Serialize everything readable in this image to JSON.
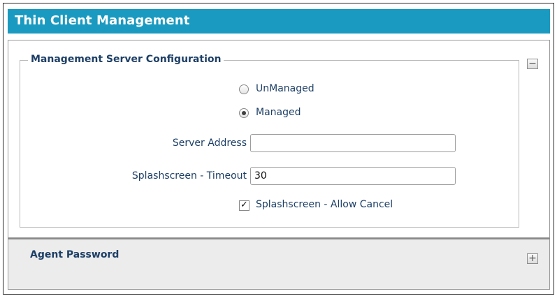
{
  "header": {
    "title": "Thin Client Management"
  },
  "management_server": {
    "legend": "Management Server Configuration",
    "collapse_symbol": "−",
    "mode_options": [
      {
        "label": "UnManaged",
        "checked": false
      },
      {
        "label": "Managed",
        "checked": true
      }
    ],
    "server_address": {
      "label": "Server Address",
      "value": ""
    },
    "splash_timeout": {
      "label": "Splashscreen - Timeout",
      "value": "30"
    },
    "allow_cancel": {
      "label": "Splashscreen - Allow Cancel",
      "checked": true,
      "mark": "✓"
    }
  },
  "agent_password": {
    "title": "Agent Password",
    "expand_symbol": "+"
  },
  "icons": [
    "collapse-minus-icon",
    "expand-plus-icon",
    "checkmark-icon"
  ],
  "colors": {
    "title_bar": "#1a9ac0",
    "label_text": "#1d3f66",
    "collapsed_panel_bg": "#ececec"
  }
}
